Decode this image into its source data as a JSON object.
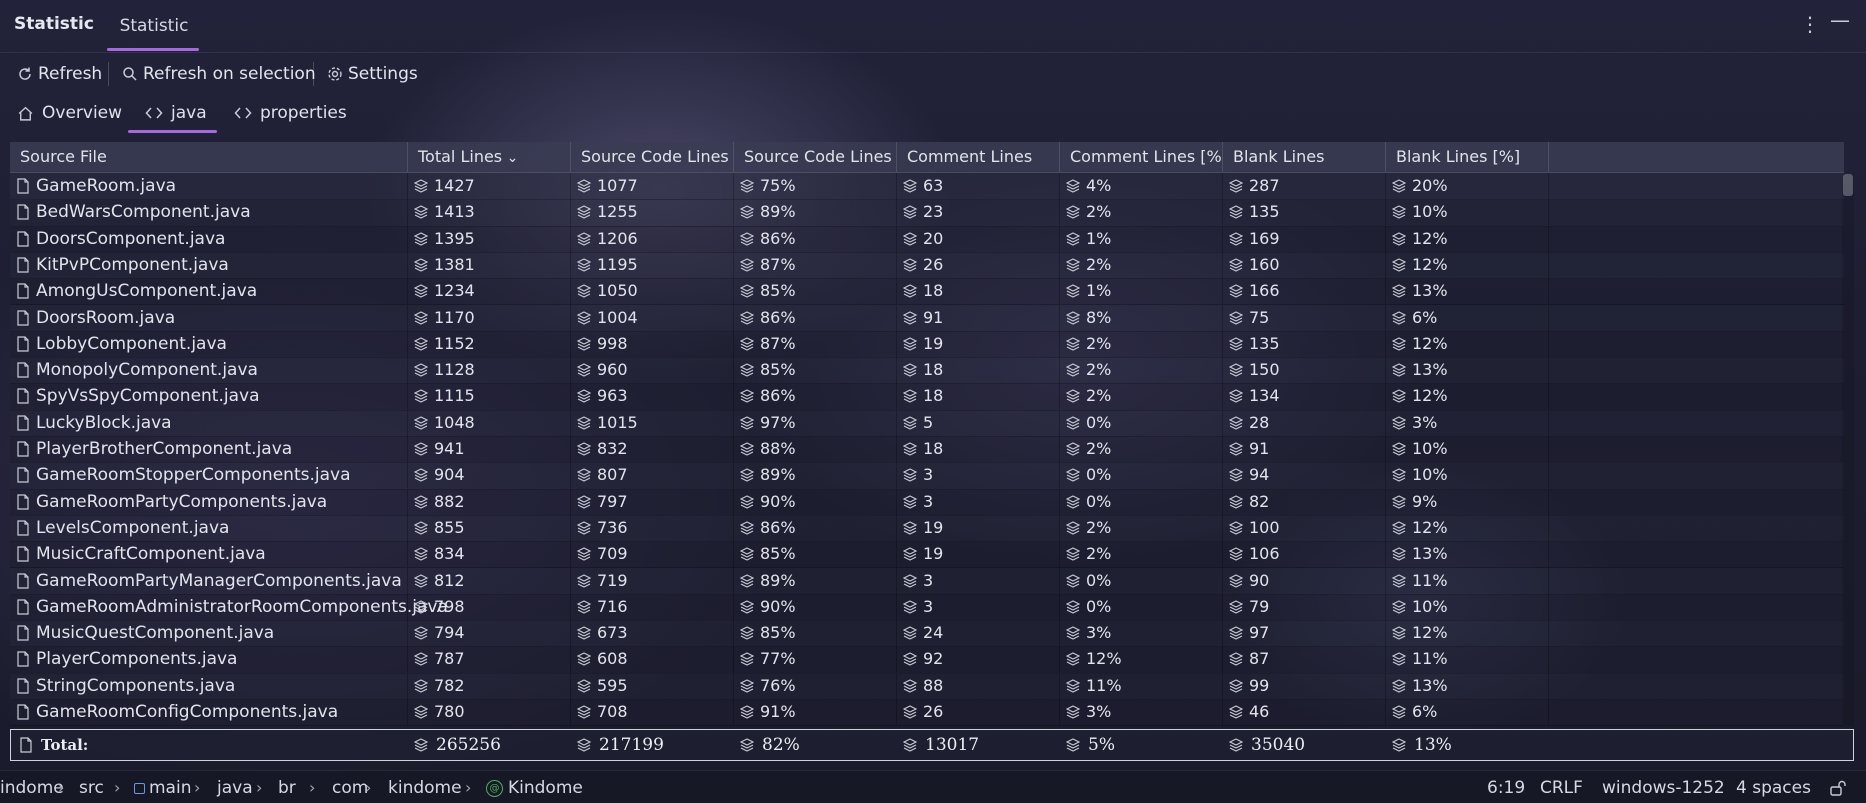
{
  "header": {
    "title": "Statistic",
    "tab": "Statistic"
  },
  "toolbar": {
    "refresh": "Refresh",
    "refresh_selection": "Refresh on selection",
    "settings": "Settings"
  },
  "subtabs": {
    "overview": "Overview",
    "java": "java",
    "properties": "properties"
  },
  "table": {
    "columns": [
      "Source File",
      "Total Lines",
      "Source Code Lines",
      "Source Code Lines [...",
      "Comment Lines",
      "Comment Lines [%]",
      "Blank Lines",
      "Blank Lines [%]"
    ],
    "rows": [
      [
        "GameRoom.java",
        "1427",
        "1077",
        "75%",
        "63",
        "4%",
        "287",
        "20%"
      ],
      [
        "BedWarsComponent.java",
        "1413",
        "1255",
        "89%",
        "23",
        "2%",
        "135",
        "10%"
      ],
      [
        "DoorsComponent.java",
        "1395",
        "1206",
        "86%",
        "20",
        "1%",
        "169",
        "12%"
      ],
      [
        "KitPvPComponent.java",
        "1381",
        "1195",
        "87%",
        "26",
        "2%",
        "160",
        "12%"
      ],
      [
        "AmongUsComponent.java",
        "1234",
        "1050",
        "85%",
        "18",
        "1%",
        "166",
        "13%"
      ],
      [
        "DoorsRoom.java",
        "1170",
        "1004",
        "86%",
        "91",
        "8%",
        "75",
        "6%"
      ],
      [
        "LobbyComponent.java",
        "1152",
        "998",
        "87%",
        "19",
        "2%",
        "135",
        "12%"
      ],
      [
        "MonopolyComponent.java",
        "1128",
        "960",
        "85%",
        "18",
        "2%",
        "150",
        "13%"
      ],
      [
        "SpyVsSpyComponent.java",
        "1115",
        "963",
        "86%",
        "18",
        "2%",
        "134",
        "12%"
      ],
      [
        "LuckyBlock.java",
        "1048",
        "1015",
        "97%",
        "5",
        "0%",
        "28",
        "3%"
      ],
      [
        "PlayerBrotherComponent.java",
        "941",
        "832",
        "88%",
        "18",
        "2%",
        "91",
        "10%"
      ],
      [
        "GameRoomStopperComponents.java",
        "904",
        "807",
        "89%",
        "3",
        "0%",
        "94",
        "10%"
      ],
      [
        "GameRoomPartyComponents.java",
        "882",
        "797",
        "90%",
        "3",
        "0%",
        "82",
        "9%"
      ],
      [
        "LevelsComponent.java",
        "855",
        "736",
        "86%",
        "19",
        "2%",
        "100",
        "12%"
      ],
      [
        "MusicCraftComponent.java",
        "834",
        "709",
        "85%",
        "19",
        "2%",
        "106",
        "13%"
      ],
      [
        "GameRoomPartyManagerComponents.java",
        "812",
        "719",
        "89%",
        "3",
        "0%",
        "90",
        "11%"
      ],
      [
        "GameRoomAdministratorRoomComponents.java",
        "798",
        "716",
        "90%",
        "3",
        "0%",
        "79",
        "10%"
      ],
      [
        "MusicQuestComponent.java",
        "794",
        "673",
        "85%",
        "24",
        "3%",
        "97",
        "12%"
      ],
      [
        "PlayerComponents.java",
        "787",
        "608",
        "77%",
        "92",
        "12%",
        "87",
        "11%"
      ],
      [
        "StringComponents.java",
        "782",
        "595",
        "76%",
        "88",
        "11%",
        "99",
        "13%"
      ],
      [
        "GameRoomConfigComponents.java",
        "780",
        "708",
        "91%",
        "26",
        "3%",
        "46",
        "6%"
      ]
    ],
    "total": [
      "Total:",
      "265256",
      "217199",
      "82%",
      "13017",
      "5%",
      "35040",
      "13%"
    ]
  },
  "statusbar": {
    "breadcrumbs": [
      "indome",
      "src",
      "main",
      "java",
      "br",
      "com",
      "kindome",
      "Kindome"
    ],
    "position": "6:19",
    "line_ending": "CRLF",
    "encoding": "windows-1252",
    "indent": "4 spaces"
  },
  "colors": {
    "accent": "#a36bdc",
    "background": "#1e1f30"
  }
}
